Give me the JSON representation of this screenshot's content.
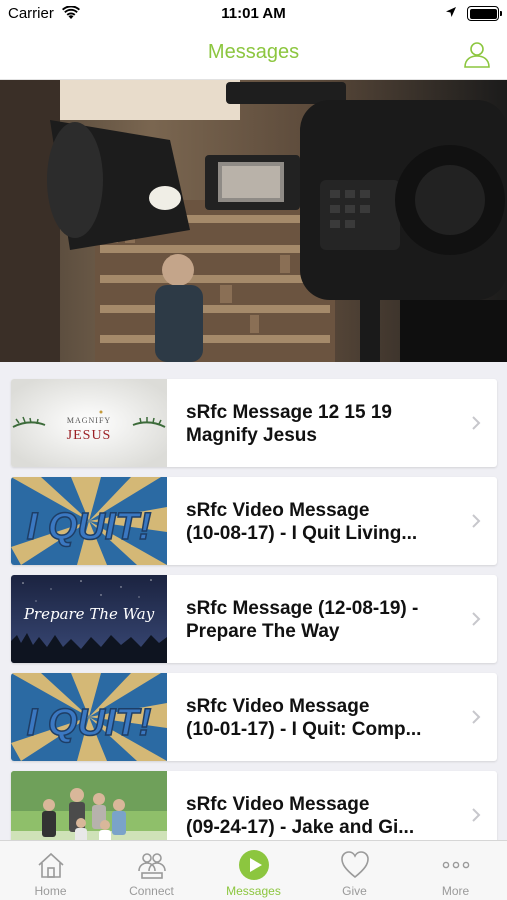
{
  "status_bar": {
    "carrier": "Carrier",
    "time": "11:01 AM"
  },
  "header": {
    "title": "Messages"
  },
  "hero": {
    "description_icon": "video-camera-photo"
  },
  "messages": [
    {
      "title": "sRfc Message 12 15 19\nMagnify Jesus",
      "thumb_text_top": "MAGNIFY",
      "thumb_text_main": "JESUS"
    },
    {
      "title": "sRfc Video Message\n(10-08-17) - I Quit Living...",
      "thumb_text_main": "I QUIT!"
    },
    {
      "title": "sRfc Message (12-08-19) -\nPrepare The Way",
      "thumb_text_main": "Prepare The Way"
    },
    {
      "title": "sRfc Video Message\n(10-01-17) - I Quit: Comp...",
      "thumb_text_main": "I QUIT!"
    },
    {
      "title": "sRfc Video Message\n(09-24-17) - Jake and Gi...",
      "thumb_text_main": ""
    }
  ],
  "tabs": [
    {
      "label": "Home",
      "icon": "home-icon"
    },
    {
      "label": "Connect",
      "icon": "people-icon"
    },
    {
      "label": "Messages",
      "icon": "play-icon",
      "active": true
    },
    {
      "label": "Give",
      "icon": "heart-icon"
    },
    {
      "label": "More",
      "icon": "more-icon"
    }
  ],
  "colors": {
    "accent": "#8cc63f"
  }
}
